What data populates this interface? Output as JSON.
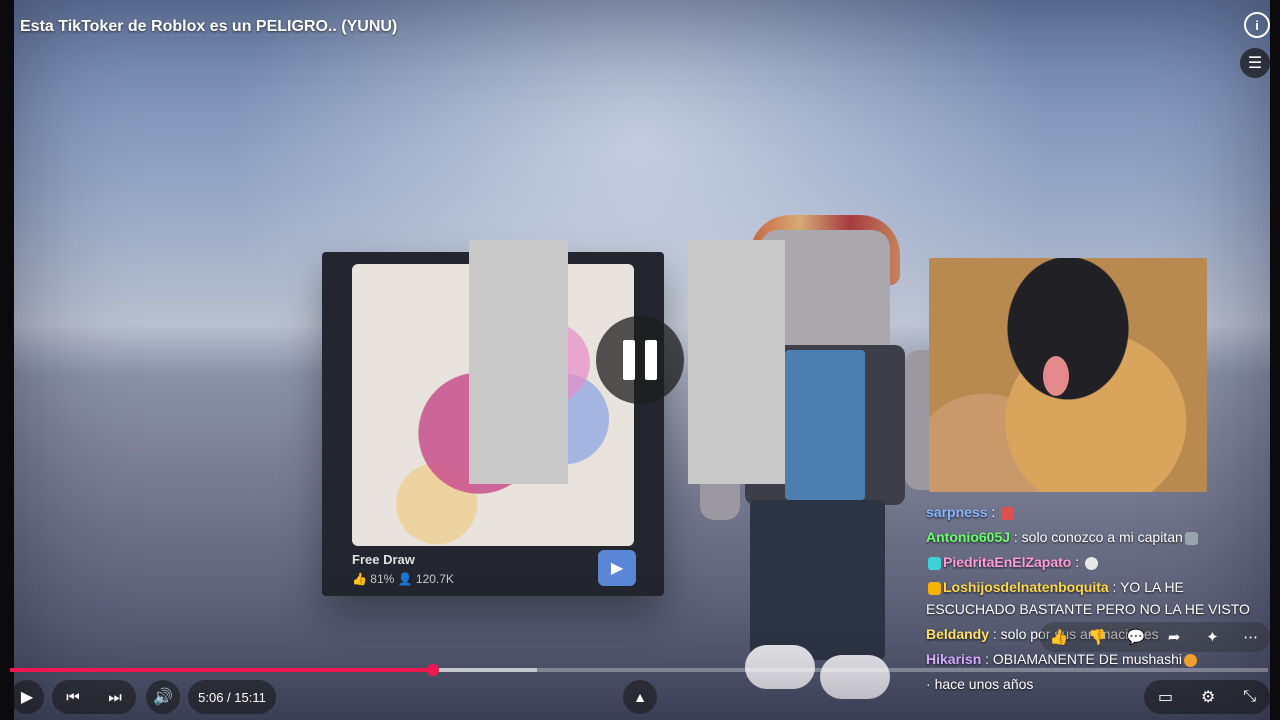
{
  "video": {
    "title": "Esta TikToker de Roblox es un PELIGRO.. (YUNU)",
    "screen_label": "Free Draw",
    "screen_stats": "👍 81%   👤 120.7K"
  },
  "icons": {
    "info": "info-icon",
    "queue": "queue-icon",
    "pause": "pause-icon"
  },
  "chat": {
    "messages": [
      {
        "user": "sarpness",
        "user_color": "#8ab4ff",
        "text": " : "
      },
      {
        "user": "Antonio605J",
        "user_color": "#6bff6b",
        "text": " : solo conozco a mi capitan"
      },
      {
        "user": "PiedritaEnElZapato",
        "user_color": "#ff9bd6",
        "text": " : "
      },
      {
        "user": "Loshijosdelnatenboquita",
        "user_color": "#ffd84a",
        "text": " : YO LA HE ESCUCHADO BASTANTE PERO NO LA HE VISTO"
      },
      {
        "user": "Beldandy",
        "user_color": "#ffe066",
        "text": " : solo por sus animaciones"
      },
      {
        "user": "Hikarisn",
        "user_color": "#d7a8ff",
        "text": " : OBIAMANENTE DE mushashi"
      }
    ],
    "footer": "hace unos años"
  },
  "player": {
    "progress_pct": 34,
    "time_display": "5:06 / 15:11"
  }
}
